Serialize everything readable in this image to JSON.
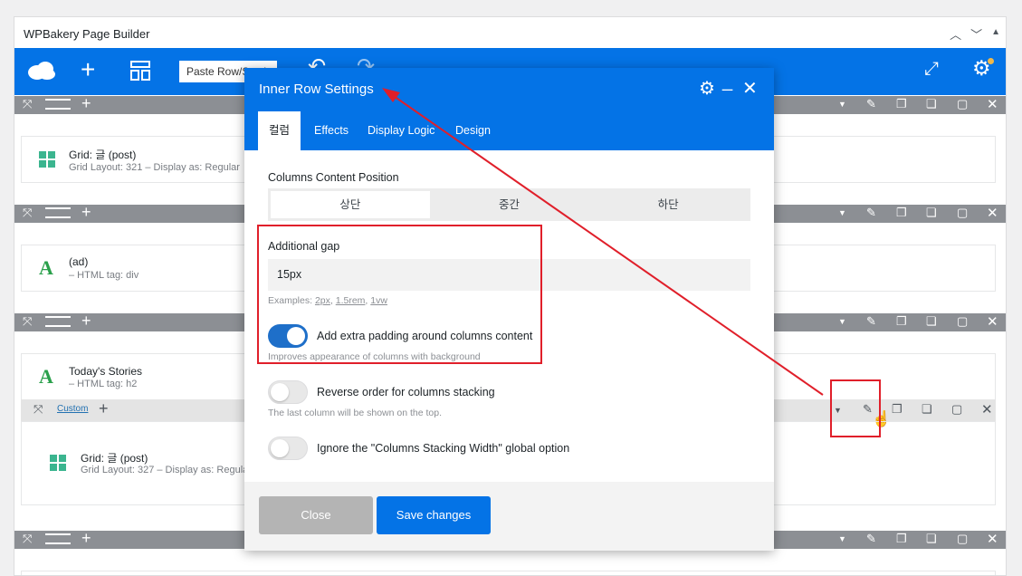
{
  "builder": {
    "title": "WPBakery Page Builder",
    "paste_label": "Paste Row/Section"
  },
  "rows": [
    {
      "type": "grid",
      "title": "Grid: 글 (post)",
      "sub": "Grid Layout: 321 – Display as: Regular"
    },
    {
      "type": "text",
      "title": "(ad)",
      "sub": "– HTML tag: div"
    },
    {
      "type": "text",
      "title": "Today's Stories",
      "sub": "– HTML tag: h2"
    },
    {
      "type": "grid",
      "title": "Grid: 글 (post)",
      "sub": "Grid Layout: 327 – Display as: Regular"
    }
  ],
  "inner_row": {
    "custom_label": "Custom"
  },
  "modal": {
    "title": "Inner Row Settings",
    "tabs": [
      "컬럼",
      "Effects",
      "Display Logic",
      "Design"
    ],
    "columns_position": {
      "label": "Columns Content Position",
      "options": [
        "상단",
        "중간",
        "하단"
      ],
      "selected": "상단"
    },
    "additional_gap": {
      "label": "Additional gap",
      "value": "15px",
      "examples_prefix": "Examples:",
      "examples": [
        "2px",
        "1.5rem",
        "1vw"
      ]
    },
    "toggles": [
      {
        "label": "Add extra padding around columns content",
        "hint": "Improves appearance of columns with background",
        "on": true
      },
      {
        "label": "Reverse order for columns stacking",
        "hint": "The last column will be shown on the top.",
        "on": false
      },
      {
        "label": "Ignore the \"Columns Stacking Width\" global option",
        "hint": "",
        "on": false
      }
    ],
    "close_label": "Close",
    "save_label": "Save changes"
  },
  "colors": {
    "accent": "#0473e6",
    "annotation": "#e01f2a",
    "row_bar": "#8c8f94",
    "grid_icon": "#3bb58f",
    "text_icon": "#2aa04b"
  }
}
